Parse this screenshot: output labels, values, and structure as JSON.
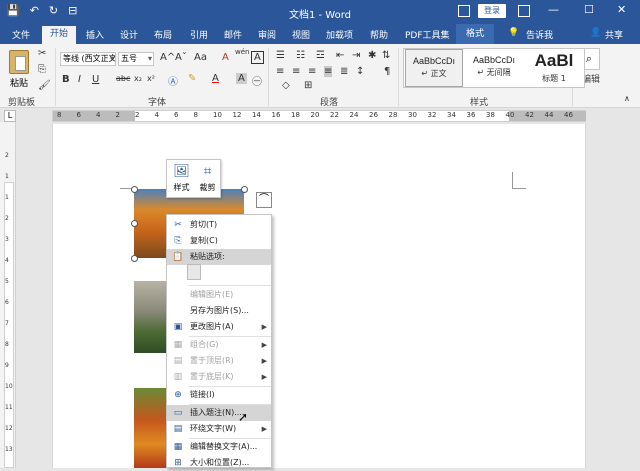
{
  "titlebar": {
    "title": "文档1 - Word",
    "login": "登录",
    "qat": [
      "💾",
      "↶",
      "↻",
      "⊟"
    ]
  },
  "tabs": {
    "file": "文件",
    "home": "开始",
    "insert": "插入",
    "design": "设计",
    "layout": "布局",
    "references": "引用",
    "mailings": "邮件",
    "review": "审阅",
    "view": "视图",
    "addins": "加载项",
    "help": "帮助",
    "pdf": "PDF工具集",
    "format": "格式",
    "tellme": "告诉我",
    "share": "共享"
  },
  "ribbon": {
    "paste_label": "粘贴",
    "font_name": "等线 (西文正文)",
    "font_size": "五号",
    "grow": "A^",
    "shrink": "Aˇ",
    "case": "Aa",
    "clear": "A",
    "wen": "wén",
    "bold": "B",
    "italic": "I",
    "underline": "U",
    "strike": "abc",
    "sub": "x₂",
    "sup": "x²",
    "groups": {
      "clipboard": "剪贴板",
      "font": "字体",
      "paragraph": "段落",
      "styles": "样式",
      "editing": "编辑"
    },
    "styles": [
      {
        "sample": "AaBbCcDı",
        "name": "↵ 正文"
      },
      {
        "sample": "AaBbCcDı",
        "name": "↵ 无间隔"
      },
      {
        "sample": "AaBl",
        "name": "标题 1"
      }
    ]
  },
  "ruler": {
    "h_numbers": [
      "8",
      "6",
      "4",
      "2",
      "2",
      "4",
      "6",
      "8",
      "10",
      "12",
      "14",
      "16",
      "18",
      "20",
      "22",
      "24",
      "26",
      "28",
      "30",
      "32",
      "34",
      "36",
      "38",
      "40",
      "42",
      "44",
      "46"
    ],
    "v_numbers": [
      "2",
      "1",
      "1",
      "2",
      "3",
      "4",
      "5",
      "6",
      "7",
      "8",
      "9",
      "10",
      "11",
      "12",
      "13"
    ]
  },
  "minitoolbar": {
    "style": "样式",
    "crop": "裁剪"
  },
  "context_menu": [
    {
      "label": "剪切(T)",
      "icon": "✂",
      "disabled": false
    },
    {
      "label": "复制(C)",
      "icon": "⎘",
      "disabled": false
    },
    {
      "label": "粘贴选项:",
      "icon": "📋",
      "disabled": false
    },
    {
      "label": "编辑图片(E)",
      "icon": "",
      "disabled": true
    },
    {
      "label": "另存为图片(S)...",
      "icon": "",
      "disabled": false
    },
    {
      "label": "更改图片(A)",
      "icon": "▣",
      "disabled": false
    },
    {
      "label": "组合(G)",
      "icon": "▦",
      "disabled": true
    },
    {
      "label": "置于顶层(R)",
      "icon": "▤",
      "disabled": true
    },
    {
      "label": "置于底层(K)",
      "icon": "▥",
      "disabled": true
    },
    {
      "label": "链接(I)",
      "icon": "⊕",
      "disabled": false
    },
    {
      "label": "插入题注(N)...",
      "icon": "▭",
      "disabled": false
    },
    {
      "label": "环绕文字(W)",
      "icon": "▤",
      "disabled": false
    },
    {
      "label": "编辑替换文字(A)...",
      "icon": "▦",
      "disabled": false
    },
    {
      "label": "大小和位置(Z)...",
      "icon": "⊞",
      "disabled": false
    }
  ]
}
